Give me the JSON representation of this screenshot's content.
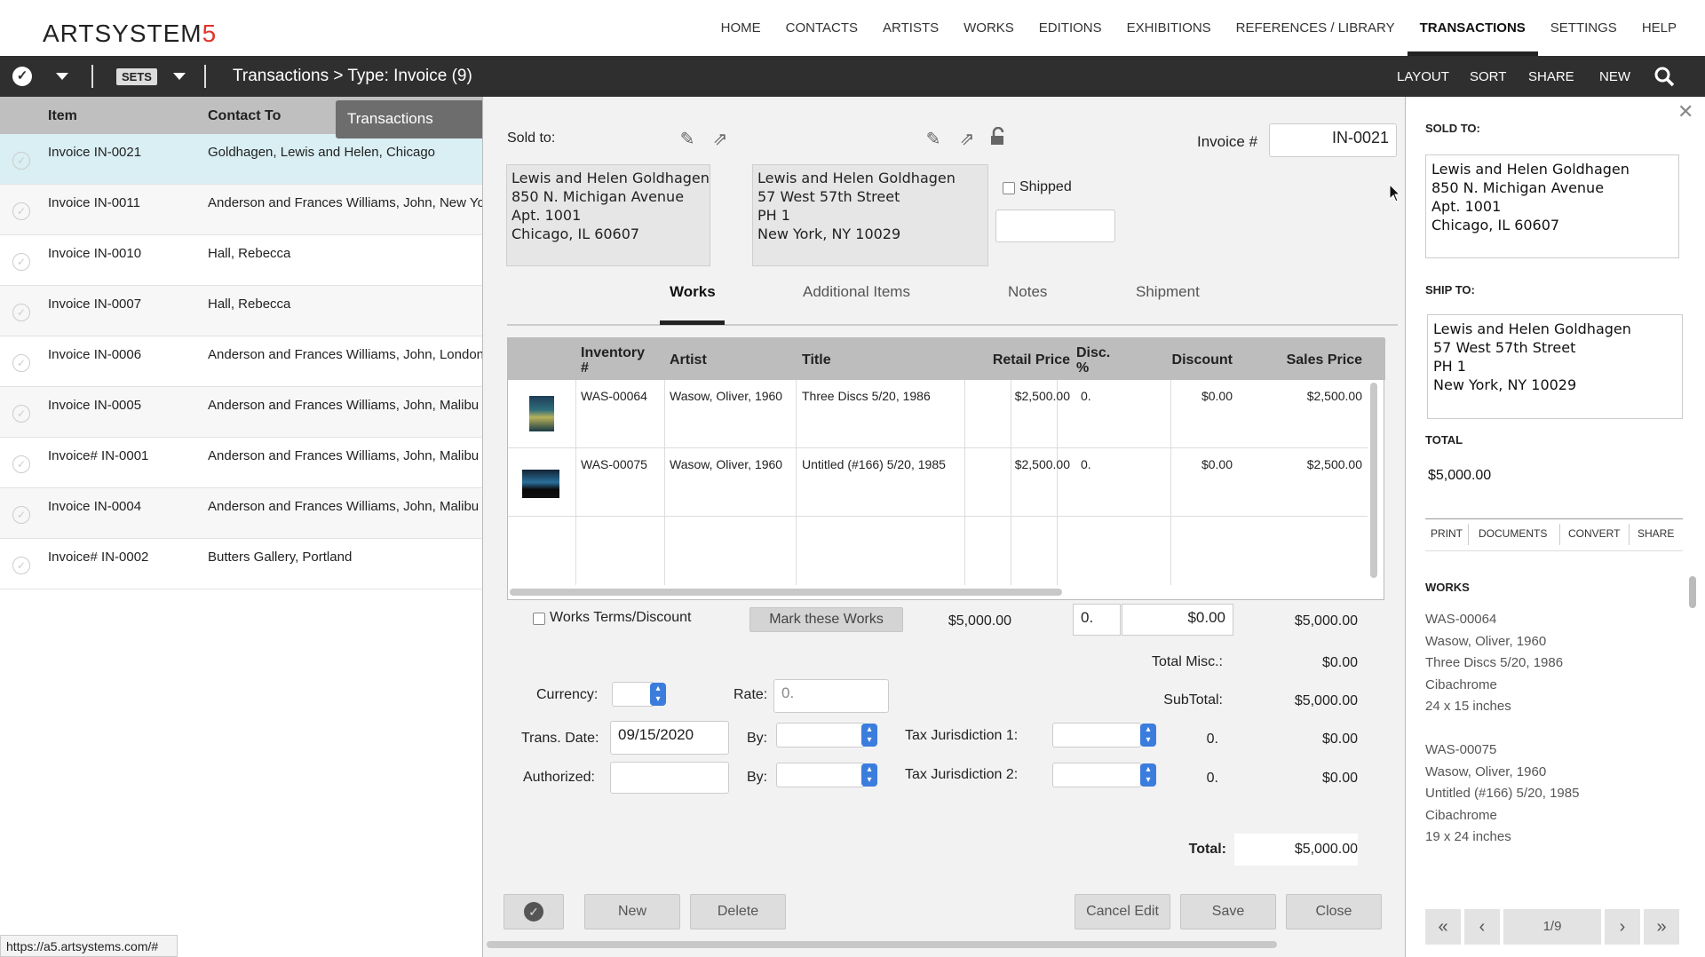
{
  "nav": {
    "logo_main": "ARTSYSTEM",
    "logo_accent": "5",
    "links": [
      "HOME",
      "CONTACTS",
      "ARTISTS",
      "WORKS",
      "EDITIONS",
      "EXHIBITIONS",
      "REFERENCES / LIBRARY",
      "TRANSACTIONS",
      "SETTINGS",
      "HELP"
    ],
    "active": "TRANSACTIONS"
  },
  "toolbar": {
    "sets_label": "SETS",
    "breadcrumb": "Transactions > Type: Invoice (9)",
    "right_actions": [
      "LAYOUT",
      "SORT",
      "SHARE",
      "NEW"
    ]
  },
  "list": {
    "col_item": "Item",
    "col_contact": "Contact To",
    "tooltip": "Transactions",
    "rows": [
      {
        "item": "Invoice IN-0021",
        "contact": "Goldhagen, Lewis and Helen, Chicago"
      },
      {
        "item": "Invoice IN-0011",
        "contact": "Anderson and Frances Williams, John, New York"
      },
      {
        "item": "Invoice IN-0010",
        "contact": "Hall, Rebecca"
      },
      {
        "item": "Invoice IN-0007",
        "contact": "Hall, Rebecca"
      },
      {
        "item": "Invoice IN-0006",
        "contact": "Anderson and Frances Williams, John, London"
      },
      {
        "item": "Invoice IN-0005",
        "contact": "Anderson and Frances Williams, John, Malibu"
      },
      {
        "item": "Invoice# IN-0001",
        "contact": "Anderson and Frances Williams, John, Malibu"
      },
      {
        "item": "Invoice IN-0004",
        "contact": "Anderson and Frances Williams, John, Malibu"
      },
      {
        "item": "Invoice# IN-0002",
        "contact": "Butters Gallery, Portland"
      }
    ],
    "status_url": "https://a5.artsystems.com/#"
  },
  "invoice": {
    "sold_to_label": "Sold to:",
    "sold_to_address": "Lewis and Helen Goldhagen\n850 N. Michigan Avenue\nApt. 1001\nChicago, IL 60607",
    "ship_to_address": "Lewis and Helen Goldhagen\n57 West 57th Street\nPH 1\nNew York, NY 10029",
    "shipped_label": "Shipped",
    "invoice_label": "Invoice #",
    "invoice_number": "IN-0021",
    "tabs": [
      "Works",
      "Additional Items",
      "Notes",
      "Shipment"
    ],
    "active_tab": "Works",
    "grid_headers": {
      "inventory": "Inventory #",
      "artist": "Artist",
      "title": "Title",
      "retail": "Retail Price",
      "disc_pct": "Disc. %",
      "discount": "Discount",
      "sales": "Sales Price"
    },
    "works": [
      {
        "inventory": "WAS-00064",
        "artist": "Wasow, Oliver, 1960",
        "title": "Three Discs 5/20, 1986",
        "retail": "$2,500.00",
        "disc_pct": "0.",
        "discount": "$0.00",
        "sales": "$2,500.00"
      },
      {
        "inventory": "WAS-00075",
        "artist": "Wasow, Oliver, 1960",
        "title": "Untitled (#166) 5/20, 1985",
        "retail": "$2,500.00",
        "disc_pct": "0.",
        "discount": "$0.00",
        "sales": "$2,500.00"
      }
    ],
    "terms_label": "Works Terms/Discount",
    "mark_button": "Mark these Works",
    "sum_retail": "$5,000.00",
    "sum_disc_pct": "0.",
    "sum_discount": "$0.00",
    "sum_sales": "$5,000.00",
    "total_misc_label": "Total Misc.:",
    "total_misc": "$0.00",
    "subtotal_label": "SubTotal:",
    "subtotal": "$5,000.00",
    "currency_label": "Currency:",
    "rate_label": "Rate:",
    "rate_placeholder": "0.",
    "trans_date_label": "Trans. Date:",
    "trans_date": "09/15/2020",
    "by_label": "By:",
    "authorized_label": "Authorized:",
    "tax1_label": "Tax Jurisdiction 1:",
    "tax2_label": "Tax Jurisdiction 2:",
    "tax1_rate": "0.",
    "tax1_amount": "$0.00",
    "tax2_rate": "0.",
    "tax2_amount": "$0.00",
    "total_label": "Total:",
    "total": "$5,000.00",
    "btn_new": "New",
    "btn_delete": "Delete",
    "btn_cancel": "Cancel Edit",
    "btn_save": "Save",
    "btn_close": "Close"
  },
  "panel": {
    "sold_to_label": "SOLD TO:",
    "sold_to": "Lewis and Helen Goldhagen\n850 N. Michigan Avenue\nApt. 1001\nChicago, IL 60607",
    "ship_to_label": "SHIP TO:",
    "ship_to": "Lewis and Helen Goldhagen\n57 West 57th Street\nPH 1\nNew York, NY 10029",
    "total_label": "TOTAL",
    "total": "$5,000.00",
    "actions": [
      "PRINT",
      "DOCUMENTS",
      "CONVERT",
      "SHARE"
    ],
    "works_label": "WORKS",
    "works": [
      {
        "inventory": "WAS-00064",
        "artist": "Wasow, Oliver, 1960",
        "title": "Three Discs 5/20, 1986",
        "medium": "Cibachrome",
        "size": "24 x 15 inches"
      },
      {
        "inventory": "WAS-00075",
        "artist": "Wasow, Oliver, 1960",
        "title": "Untitled (#166) 5/20, 1985",
        "medium": "Cibachrome",
        "size": "19 x 24 inches"
      }
    ],
    "page_indicator": "1/9"
  }
}
